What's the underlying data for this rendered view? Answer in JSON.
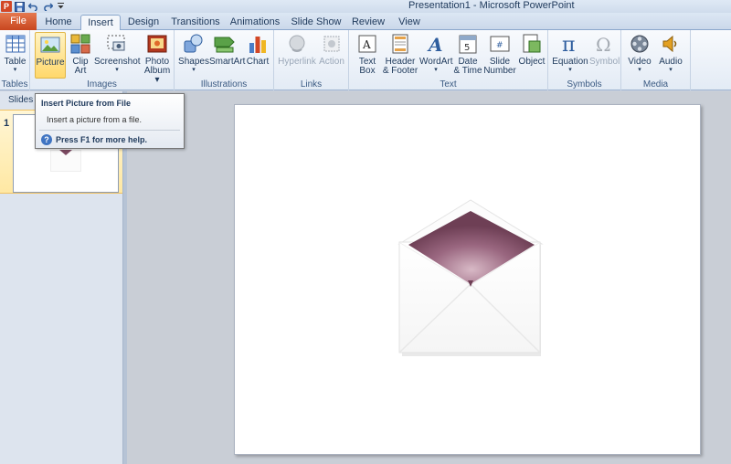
{
  "window": {
    "title": "Presentation1  -  Microsoft PowerPoint",
    "app_icon_letter": "P"
  },
  "quick_access": [
    {
      "name": "save-icon"
    },
    {
      "name": "undo-icon"
    },
    {
      "name": "redo-icon"
    },
    {
      "name": "customize-icon"
    }
  ],
  "tabs": [
    {
      "label": "File",
      "name": "tab-file"
    },
    {
      "label": "Home",
      "name": "tab-home"
    },
    {
      "label": "Insert",
      "name": "tab-insert",
      "active": true
    },
    {
      "label": "Design",
      "name": "tab-design"
    },
    {
      "label": "Transitions",
      "name": "tab-transitions"
    },
    {
      "label": "Animations",
      "name": "tab-animations"
    },
    {
      "label": "Slide Show",
      "name": "tab-slide-show"
    },
    {
      "label": "Review",
      "name": "tab-review"
    },
    {
      "label": "View",
      "name": "tab-view"
    }
  ],
  "ribbon": {
    "groups": {
      "tables": "Tables",
      "images": "Images",
      "illustrations": "Illustrations",
      "links": "Links",
      "text": "Text",
      "symbols": "Symbols",
      "media": "Media"
    },
    "buttons": {
      "table": {
        "line1": "Table",
        "line2": "▾"
      },
      "picture": {
        "line1": "Picture",
        "line2": ""
      },
      "clip_art": {
        "line1": "Clip",
        "line2": "Art"
      },
      "screenshot": {
        "line1": "Screenshot",
        "line2": "▾"
      },
      "photo_album": {
        "line1": "Photo",
        "line2": "Album ▾"
      },
      "shapes": {
        "line1": "Shapes",
        "line2": "▾"
      },
      "smartart": {
        "line1": "SmartArt",
        "line2": ""
      },
      "chart": {
        "line1": "Chart",
        "line2": ""
      },
      "hyperlink": {
        "line1": "Hyperlink",
        "line2": ""
      },
      "action": {
        "line1": "Action",
        "line2": ""
      },
      "text_box": {
        "line1": "Text",
        "line2": "Box"
      },
      "header_footer": {
        "line1": "Header",
        "line2": "& Footer"
      },
      "wordart": {
        "line1": "WordArt",
        "line2": "▾"
      },
      "date_time": {
        "line1": "Date",
        "line2": "& Time"
      },
      "slide_number": {
        "line1": "Slide",
        "line2": "Number"
      },
      "object": {
        "line1": "Object",
        "line2": ""
      },
      "equation": {
        "line1": "Equation",
        "line2": "▾"
      },
      "symbol": {
        "line1": "Symbol",
        "line2": ""
      },
      "video": {
        "line1": "Video",
        "line2": "▾"
      },
      "audio": {
        "line1": "Audio",
        "line2": "▾"
      }
    }
  },
  "slides_panel": {
    "tab_label": "Slides",
    "slide_number": "1"
  },
  "tooltip": {
    "title": "Insert Picture from File",
    "description": "Insert a picture from a file.",
    "help_text": "Press F1 for more help.",
    "help_icon": "?"
  },
  "colors": {
    "file_tab": "#d24726",
    "envelope_liner": "#7d4a62",
    "accent": "#1e395b"
  }
}
